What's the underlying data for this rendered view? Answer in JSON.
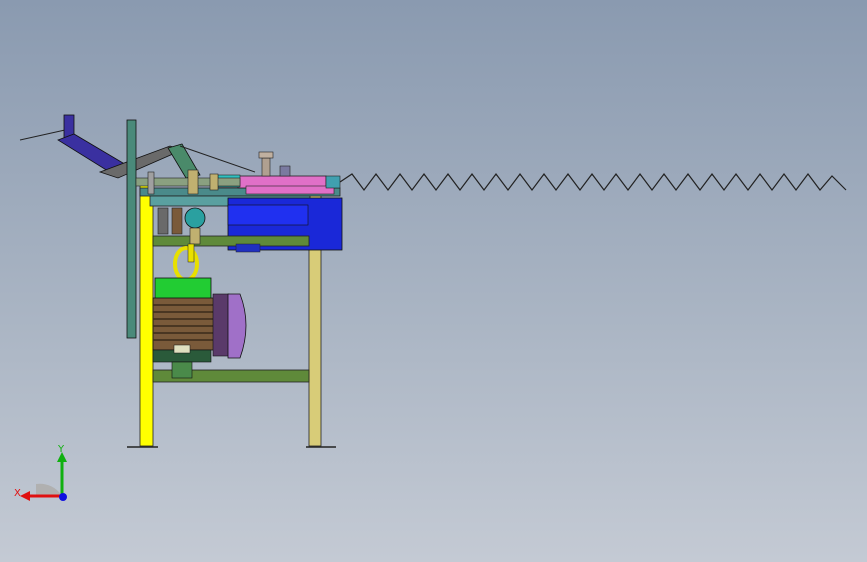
{
  "viewport": {
    "background_top": "#8a9ab0",
    "background_bottom": "#c4cad4"
  },
  "model": {
    "frame_color": "#ffff00",
    "rear_post_color": "#d8cc78",
    "crossbar_color": "#5f8a3a",
    "motor_body_color": "#7a5a3a",
    "motor_endcap_color": "#a070c8",
    "motor_top_color": "#22cc33",
    "gearbox_color": "#1a28d8",
    "rail_color": "#4a8a8a",
    "slider_color": "#e070c8",
    "arm_color": "#3a30a0",
    "hook_color": "#e8e000",
    "wire_color": "#222222"
  },
  "triad": {
    "x_label": "X",
    "y_label": "Y",
    "x_color": "#e01010",
    "y_color": "#10b010",
    "z_color": "#1010e0"
  }
}
